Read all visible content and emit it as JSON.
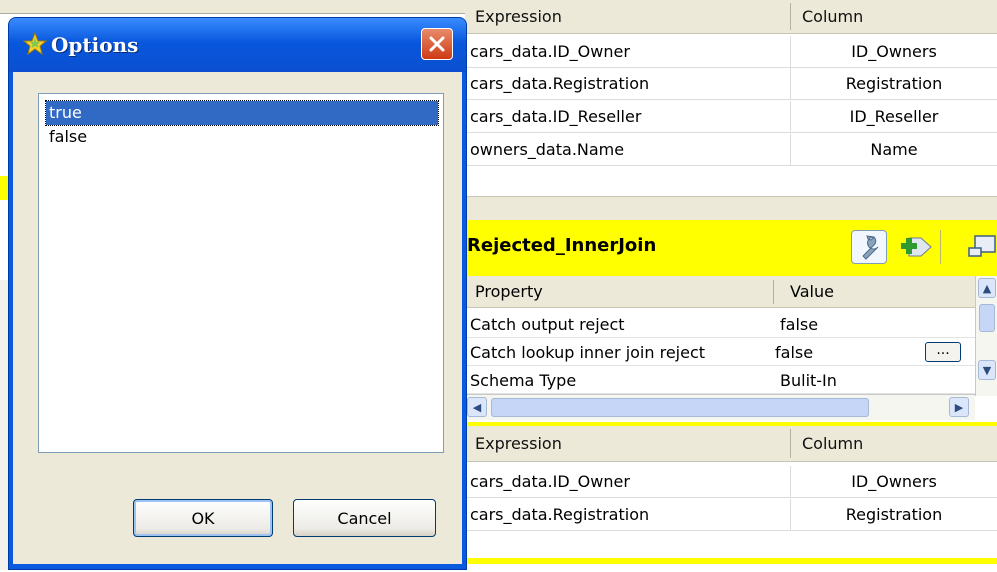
{
  "dialog": {
    "title": "Options",
    "options": [
      "true",
      "false"
    ],
    "selected": "true",
    "ok_label": "OK",
    "cancel_label": "Cancel"
  },
  "top_table": {
    "col_expression": "Expression",
    "col_column": "Column",
    "rows": [
      {
        "expression": "cars_data.ID_Owner",
        "column": "ID_Owners"
      },
      {
        "expression": "cars_data.Registration",
        "column": "Registration"
      },
      {
        "expression": "cars_data.ID_Reseller",
        "column": "ID_Reseller"
      },
      {
        "expression": "owners_data.Name",
        "column": "Name"
      }
    ]
  },
  "rejected": {
    "title": "Rejected_InnerJoin",
    "col_property": "Property",
    "col_value": "Value",
    "properties": [
      {
        "property": "Catch output reject",
        "value": "false"
      },
      {
        "property": "Catch lookup inner join reject",
        "value": "false",
        "button": "..."
      },
      {
        "property": "Schema Type",
        "value": "Bulit-In"
      }
    ]
  },
  "bottom_table": {
    "col_expression": "Expression",
    "col_column": "Column",
    "rows": [
      {
        "expression": "cars_data.ID_Owner",
        "column": "ID_Owners"
      },
      {
        "expression": "cars_data.Registration",
        "column": "Registration"
      }
    ]
  },
  "colors": {
    "titlebar": "#0857dd",
    "selection": "#316ac5",
    "highlight": "#ffff00",
    "header": "#ece9d8"
  }
}
